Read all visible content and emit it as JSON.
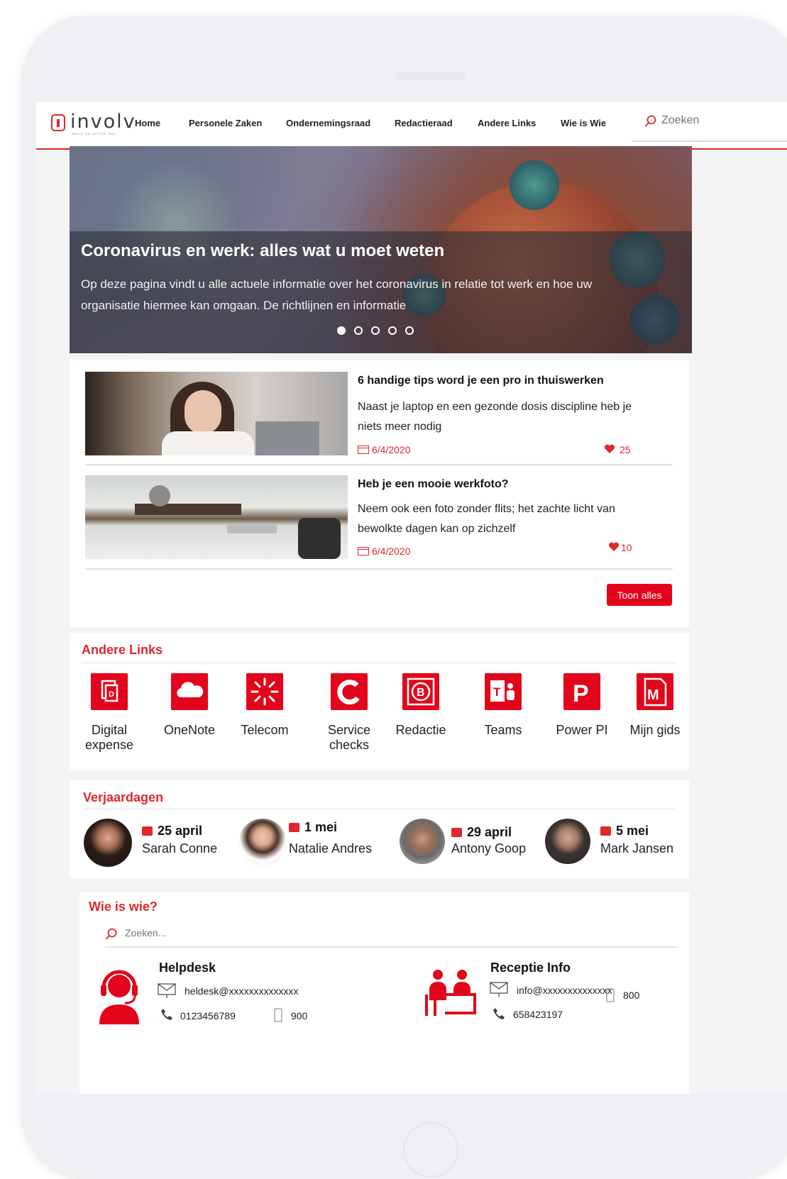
{
  "nav": {
    "logo_text": "involv",
    "logo_tagline": "BUILT ON OFFICE 365",
    "items": [
      "Home",
      "Personele Zaken",
      "Ondernemingsraad",
      "Redactieraad",
      "Andere Links",
      "Wie is Wie"
    ],
    "search_placeholder": "Zoeken"
  },
  "hero": {
    "title": "Coronavirus en werk: alles wat u moet weten",
    "text": "Op deze pagina vindt u alle actuele informatie over het coronavirus in relatie tot werk en hoe uw organisatie hiermee kan omgaan. De richtlijnen en informatie",
    "slide_count": 5,
    "active_slide": 1
  },
  "news": {
    "items": [
      {
        "title": "6 handige tips word je een pro in thuiswerken",
        "description": "Naast je laptop en een gezonde dosis discipline heb je niets meer nodig",
        "date": "6/4/2020",
        "likes": "25"
      },
      {
        "title": "Heb je een mooie werkfoto?",
        "description": "Neem ook een foto zonder flits; het zachte licht van bewolkte dagen kan op zichzelf",
        "date": "6/4/2020",
        "likes": "10"
      }
    ],
    "show_all_label": "Toon alles"
  },
  "links": {
    "title": "Andere Links",
    "apps": [
      {
        "label": "Digital expense",
        "icon": "document-icon"
      },
      {
        "label": "OneNote",
        "icon": "cloud-icon"
      },
      {
        "label": "Telecom",
        "icon": "burst-icon"
      },
      {
        "label": "Service checks",
        "icon": "refresh-icon"
      },
      {
        "label": "Redactie",
        "icon": "b-circle-icon"
      },
      {
        "label": "Teams",
        "icon": "teams-icon"
      },
      {
        "label": "Power PI",
        "icon": "powerpoint-icon"
      },
      {
        "label": "Mijn gids",
        "icon": "m-document-icon"
      }
    ]
  },
  "birthdays": {
    "title": "Verjaardagen",
    "people": [
      {
        "date": "25 april",
        "name": "Sarah Conne"
      },
      {
        "date": "1 mei",
        "name": "Natalie Andres"
      },
      {
        "date": "29 april",
        "name": "Antony Goop"
      },
      {
        "date": "5 mei",
        "name": "Mark Jansen"
      }
    ]
  },
  "wie": {
    "title": "Wie is wie?",
    "search_placeholder": "Zoeken...",
    "contacts": [
      {
        "name": "Helpdesk",
        "email": "heldesk@xxxxxxxxxxxxxx",
        "phone": "0123456789",
        "ext": "900",
        "icon": "headset-icon"
      },
      {
        "name": "Receptie Info",
        "email": "info@xxxxxxxxxxxxxx",
        "phone": "658423197",
        "ext": "800",
        "icon": "reception-icon"
      }
    ]
  },
  "colors": {
    "accent": "#e0272d",
    "button": "#e3051b"
  }
}
